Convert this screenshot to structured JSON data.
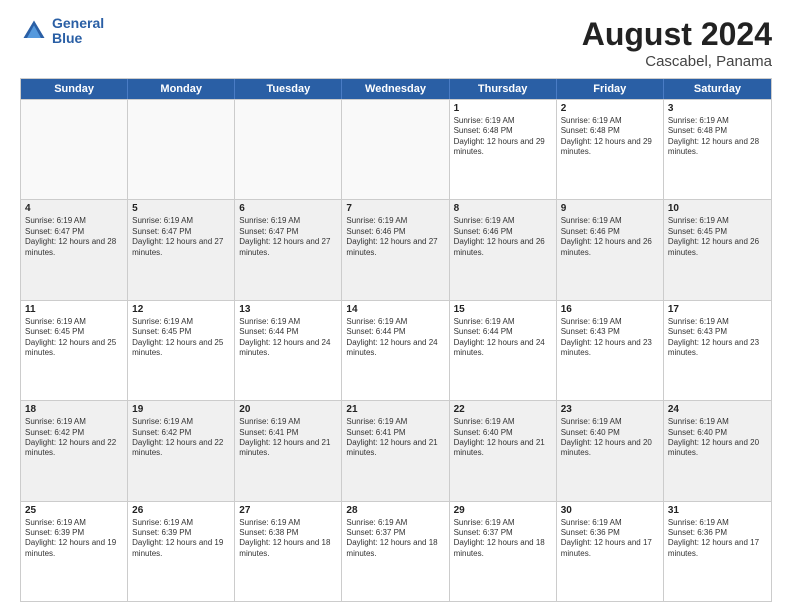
{
  "header": {
    "logo_line1": "General",
    "logo_line2": "Blue",
    "month_title": "August 2024",
    "location": "Cascabel, Panama"
  },
  "weekdays": [
    "Sunday",
    "Monday",
    "Tuesday",
    "Wednesday",
    "Thursday",
    "Friday",
    "Saturday"
  ],
  "rows": [
    [
      {
        "day": "",
        "text": ""
      },
      {
        "day": "",
        "text": ""
      },
      {
        "day": "",
        "text": ""
      },
      {
        "day": "",
        "text": ""
      },
      {
        "day": "1",
        "text": "Sunrise: 6:19 AM\nSunset: 6:48 PM\nDaylight: 12 hours and 29 minutes."
      },
      {
        "day": "2",
        "text": "Sunrise: 6:19 AM\nSunset: 6:48 PM\nDaylight: 12 hours and 29 minutes."
      },
      {
        "day": "3",
        "text": "Sunrise: 6:19 AM\nSunset: 6:48 PM\nDaylight: 12 hours and 28 minutes."
      }
    ],
    [
      {
        "day": "4",
        "text": "Sunrise: 6:19 AM\nSunset: 6:47 PM\nDaylight: 12 hours and 28 minutes."
      },
      {
        "day": "5",
        "text": "Sunrise: 6:19 AM\nSunset: 6:47 PM\nDaylight: 12 hours and 27 minutes."
      },
      {
        "day": "6",
        "text": "Sunrise: 6:19 AM\nSunset: 6:47 PM\nDaylight: 12 hours and 27 minutes."
      },
      {
        "day": "7",
        "text": "Sunrise: 6:19 AM\nSunset: 6:46 PM\nDaylight: 12 hours and 27 minutes."
      },
      {
        "day": "8",
        "text": "Sunrise: 6:19 AM\nSunset: 6:46 PM\nDaylight: 12 hours and 26 minutes."
      },
      {
        "day": "9",
        "text": "Sunrise: 6:19 AM\nSunset: 6:46 PM\nDaylight: 12 hours and 26 minutes."
      },
      {
        "day": "10",
        "text": "Sunrise: 6:19 AM\nSunset: 6:45 PM\nDaylight: 12 hours and 26 minutes."
      }
    ],
    [
      {
        "day": "11",
        "text": "Sunrise: 6:19 AM\nSunset: 6:45 PM\nDaylight: 12 hours and 25 minutes."
      },
      {
        "day": "12",
        "text": "Sunrise: 6:19 AM\nSunset: 6:45 PM\nDaylight: 12 hours and 25 minutes."
      },
      {
        "day": "13",
        "text": "Sunrise: 6:19 AM\nSunset: 6:44 PM\nDaylight: 12 hours and 24 minutes."
      },
      {
        "day": "14",
        "text": "Sunrise: 6:19 AM\nSunset: 6:44 PM\nDaylight: 12 hours and 24 minutes."
      },
      {
        "day": "15",
        "text": "Sunrise: 6:19 AM\nSunset: 6:44 PM\nDaylight: 12 hours and 24 minutes."
      },
      {
        "day": "16",
        "text": "Sunrise: 6:19 AM\nSunset: 6:43 PM\nDaylight: 12 hours and 23 minutes."
      },
      {
        "day": "17",
        "text": "Sunrise: 6:19 AM\nSunset: 6:43 PM\nDaylight: 12 hours and 23 minutes."
      }
    ],
    [
      {
        "day": "18",
        "text": "Sunrise: 6:19 AM\nSunset: 6:42 PM\nDaylight: 12 hours and 22 minutes."
      },
      {
        "day": "19",
        "text": "Sunrise: 6:19 AM\nSunset: 6:42 PM\nDaylight: 12 hours and 22 minutes."
      },
      {
        "day": "20",
        "text": "Sunrise: 6:19 AM\nSunset: 6:41 PM\nDaylight: 12 hours and 21 minutes."
      },
      {
        "day": "21",
        "text": "Sunrise: 6:19 AM\nSunset: 6:41 PM\nDaylight: 12 hours and 21 minutes."
      },
      {
        "day": "22",
        "text": "Sunrise: 6:19 AM\nSunset: 6:40 PM\nDaylight: 12 hours and 21 minutes."
      },
      {
        "day": "23",
        "text": "Sunrise: 6:19 AM\nSunset: 6:40 PM\nDaylight: 12 hours and 20 minutes."
      },
      {
        "day": "24",
        "text": "Sunrise: 6:19 AM\nSunset: 6:40 PM\nDaylight: 12 hours and 20 minutes."
      }
    ],
    [
      {
        "day": "25",
        "text": "Sunrise: 6:19 AM\nSunset: 6:39 PM\nDaylight: 12 hours and 19 minutes."
      },
      {
        "day": "26",
        "text": "Sunrise: 6:19 AM\nSunset: 6:39 PM\nDaylight: 12 hours and 19 minutes."
      },
      {
        "day": "27",
        "text": "Sunrise: 6:19 AM\nSunset: 6:38 PM\nDaylight: 12 hours and 18 minutes."
      },
      {
        "day": "28",
        "text": "Sunrise: 6:19 AM\nSunset: 6:37 PM\nDaylight: 12 hours and 18 minutes."
      },
      {
        "day": "29",
        "text": "Sunrise: 6:19 AM\nSunset: 6:37 PM\nDaylight: 12 hours and 18 minutes."
      },
      {
        "day": "30",
        "text": "Sunrise: 6:19 AM\nSunset: 6:36 PM\nDaylight: 12 hours and 17 minutes."
      },
      {
        "day": "31",
        "text": "Sunrise: 6:19 AM\nSunset: 6:36 PM\nDaylight: 12 hours and 17 minutes."
      }
    ]
  ]
}
